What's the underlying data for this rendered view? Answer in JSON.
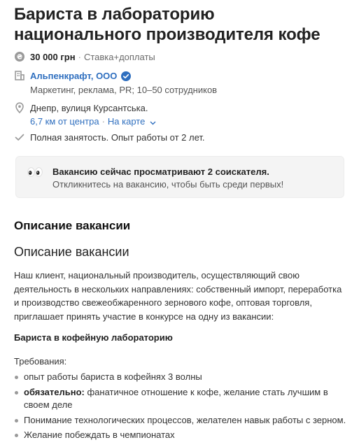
{
  "vacancy": {
    "title": "Бариста в лабораторию национального производителя кофе"
  },
  "salary": {
    "amount": "30 000 грн",
    "separator": "·",
    "note": "Ставка+доплаты",
    "icon": "coin-icon"
  },
  "company": {
    "name": "Альпенкрафт, ООО",
    "details": "Маркетинг, реклама, PR; 10–50 сотрудников",
    "icon": "building-icon",
    "verified_icon": "verified-check-icon"
  },
  "location": {
    "address": "Днепр, вулиця Курсантська.",
    "distance": "6,7 км от центра",
    "separator": "·",
    "map_link": "На карте",
    "icon": "map-pin-icon"
  },
  "employment": {
    "text": "Полная занятость. Опыт работы от 2 лет.",
    "icon": "checkmark-icon"
  },
  "notice": {
    "title": "Вакансию сейчас просматривают 2 соискателя.",
    "subtitle": "Откликнитесь на вакансию, чтобы быть среди первых!",
    "icon": "eyes-icon"
  },
  "description": {
    "section_heading": "Описание вакансии",
    "heading": "Описание вакансии",
    "intro": "Наш клиент, национальный производитель, осуществляющий свою деятельность в нескольких направлениях: собственный импорт, переработка и производство свежеобжаренного зернового кофе, оптовая торговля, приглашает принять участие в конкурсе на одну из вакансии:",
    "position_heading": "Бариста в кофейную лабораторию",
    "requirements_label": "Требования:",
    "requirements": [
      {
        "bold": "",
        "text": "опыт работы бариста в кофейнях 3 волны"
      },
      {
        "bold": "обязательно:",
        "text": " фанатичное отношение к кофе, желание стать лучшим в своем деле"
      },
      {
        "bold": "",
        "text": "Понимание технологических процессов, желателен навык работы с зерном."
      },
      {
        "bold": "",
        "text": "Желание побеждать в чемпионатах"
      }
    ]
  },
  "colors": {
    "link": "#2f6fbf",
    "notice_bg": "#f4f4f4",
    "icon_gray": "#9a9a9a"
  }
}
